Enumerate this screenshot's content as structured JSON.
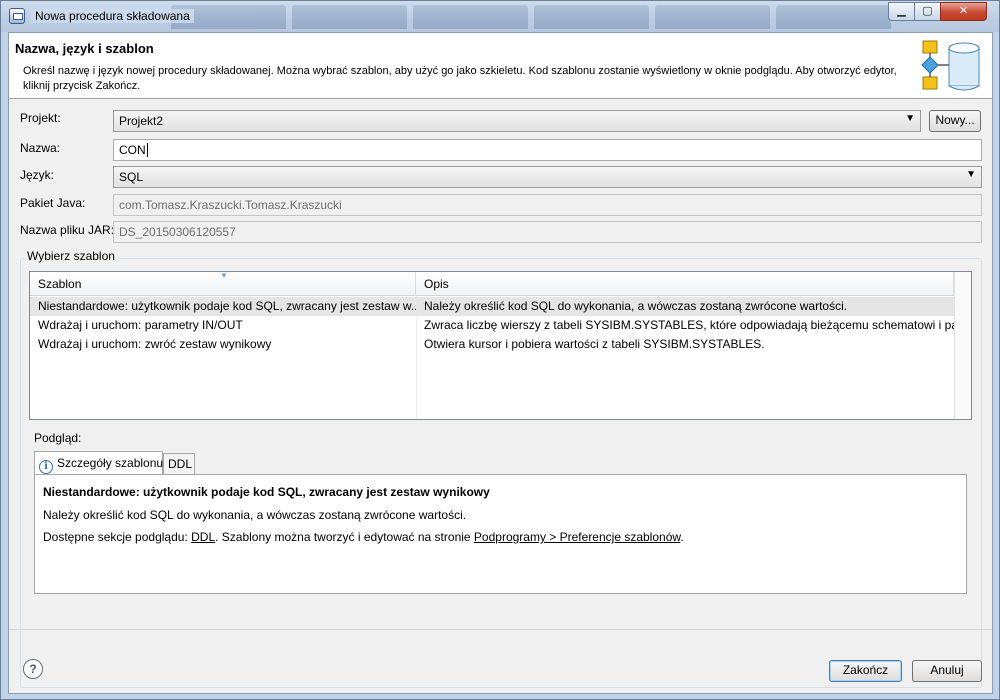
{
  "window": {
    "title": "Nowa procedura składowana"
  },
  "header": {
    "title": "Nazwa, język i szablon",
    "description": "Określ nazwę i język nowej procedury składowanej. Można wybrać szablon, aby użyć go jako szkieletu. Kod szablonu zostanie wyświetlony w oknie podglądu. Aby otworzyć edytor, kliknij przycisk Zakończ."
  },
  "form": {
    "project_label": "Projekt:",
    "project_value": "Projekt2",
    "new_button": "Nowy...",
    "name_label": "Nazwa:",
    "name_value": "CON",
    "language_label": "Język:",
    "language_value": "SQL",
    "java_package_label": "Pakiet Java:",
    "java_package_value": "com.Tomasz.Kraszucki.Tomasz.Kraszucki",
    "jar_label": "Nazwa pliku JAR:",
    "jar_value": "DS_20150306120557"
  },
  "templates": {
    "group_title": "Wybierz szablon",
    "columns": [
      "Szablon",
      "Opis"
    ],
    "rows": [
      {
        "name": "Niestandardowe: użytkownik podaje kod SQL, zwracany jest zestaw w...",
        "desc": "Należy określić kod SQL do wykonania, a wówczas zostaną zwrócone wartości."
      },
      {
        "name": "Wdrażaj i uruchom: parametry IN/OUT",
        "desc": "Zwraca liczbę wierszy z tabeli SYSIBM.SYSTABLES, które odpowiadają bieżącemu schematowi i par..."
      },
      {
        "name": "Wdrażaj i uruchom: zwróć zestaw wynikowy",
        "desc": "Otwiera kursor i pobiera wartości z tabeli SYSIBM.SYSTABLES."
      }
    ]
  },
  "preview": {
    "label": "Podgląd:",
    "tabs": [
      "Szczegóły szablonu",
      "DDL"
    ],
    "title": "Niestandardowe: użytkownik podaje kod SQL, zwracany jest zestaw wynikowy",
    "description": "Należy określić kod SQL do wykonania, a wówczas zostaną zwrócone wartości.",
    "sections_prefix": "Dostępne sekcje podglądu: ",
    "sections_link": "DDL",
    "sections_middle": ". Szablony można tworzyć i edytować na stronie ",
    "sections_link2": "Podprogramy > Preferencje szablonów",
    "sections_suffix": "."
  },
  "buttons": {
    "finish": "Zakończ",
    "cancel": "Anuluj"
  },
  "icons": {
    "help": "help-icon",
    "info": "info-icon",
    "wizard": "stored-procedure-wizard-icon"
  }
}
